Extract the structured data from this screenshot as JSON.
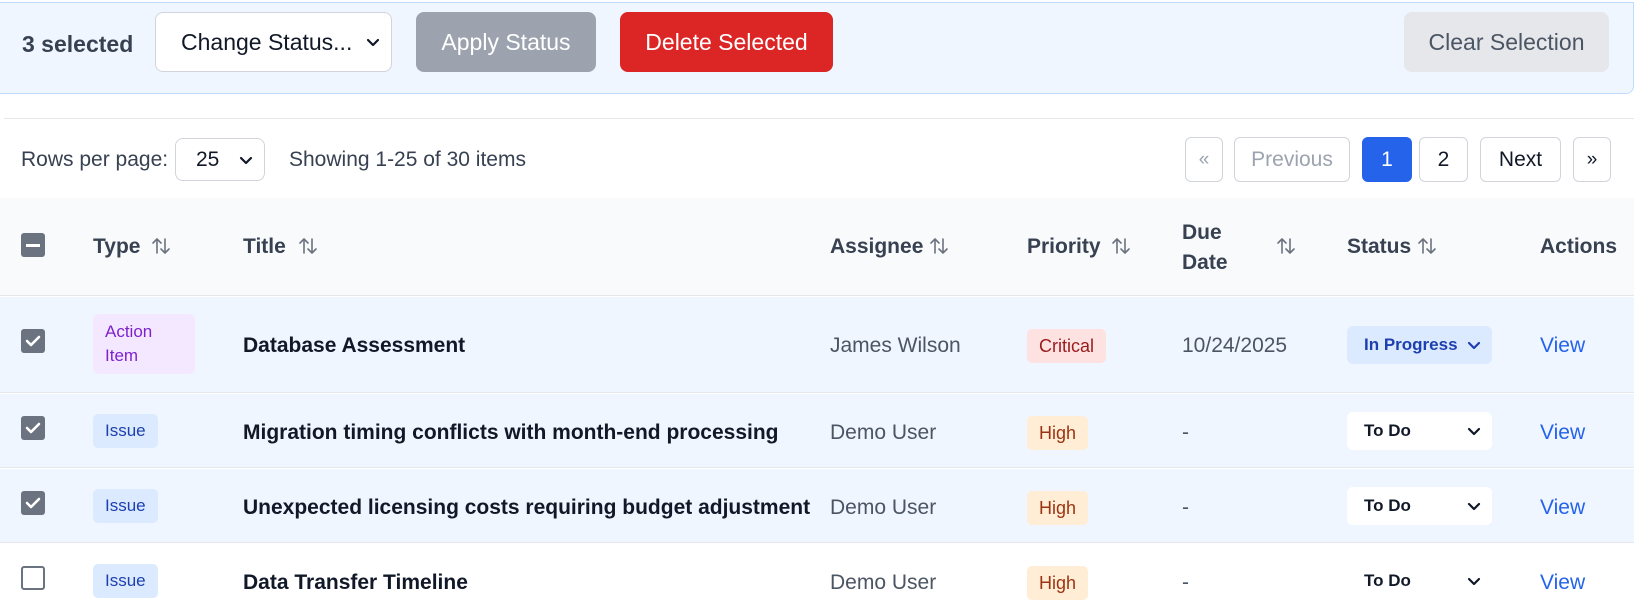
{
  "bulk_bar": {
    "selected_count": "3 selected",
    "status_select_value": "Change Status...",
    "apply_label": "Apply Status",
    "delete_label": "Delete Selected",
    "clear_label": "Clear Selection"
  },
  "pagination": {
    "rows_label": "Rows per page:",
    "rows_value": "25",
    "showing_text": "Showing 1-25 of 30 items",
    "first": "«",
    "previous": "Previous",
    "page1": "1",
    "page2": "2",
    "next": "Next",
    "last": "»"
  },
  "table": {
    "headers": {
      "type": "Type",
      "title": "Title",
      "assignee": "Assignee",
      "priority": "Priority",
      "due_date_1": "Due",
      "due_date_2": "Date",
      "status": "Status",
      "actions": "Actions"
    },
    "rows": [
      {
        "checked": true,
        "type": "Action Item",
        "title": "Database Assessment",
        "assignee": "James Wilson",
        "priority": "Critical",
        "due": "10/24/2025",
        "status": "In Progress",
        "action": "View"
      },
      {
        "checked": true,
        "type": "Issue",
        "title": "Migration timing conflicts with month-end processing",
        "assignee": "Demo User",
        "priority": "High",
        "due": "-",
        "status": "To Do",
        "action": "View"
      },
      {
        "checked": true,
        "type": "Issue",
        "title": "Unexpected licensing costs requiring budget adjustment",
        "assignee": "Demo User",
        "priority": "High",
        "due": "-",
        "status": "To Do",
        "action": "View"
      },
      {
        "checked": false,
        "type": "Issue",
        "title": "Data Transfer Timeline",
        "assignee": "Demo User",
        "priority": "High",
        "due": "-",
        "status": "To Do",
        "action": "View"
      }
    ]
  },
  "colors": {
    "primary": "#2563eb",
    "danger": "#dc2626",
    "bulk_bg": "#eff6ff"
  }
}
